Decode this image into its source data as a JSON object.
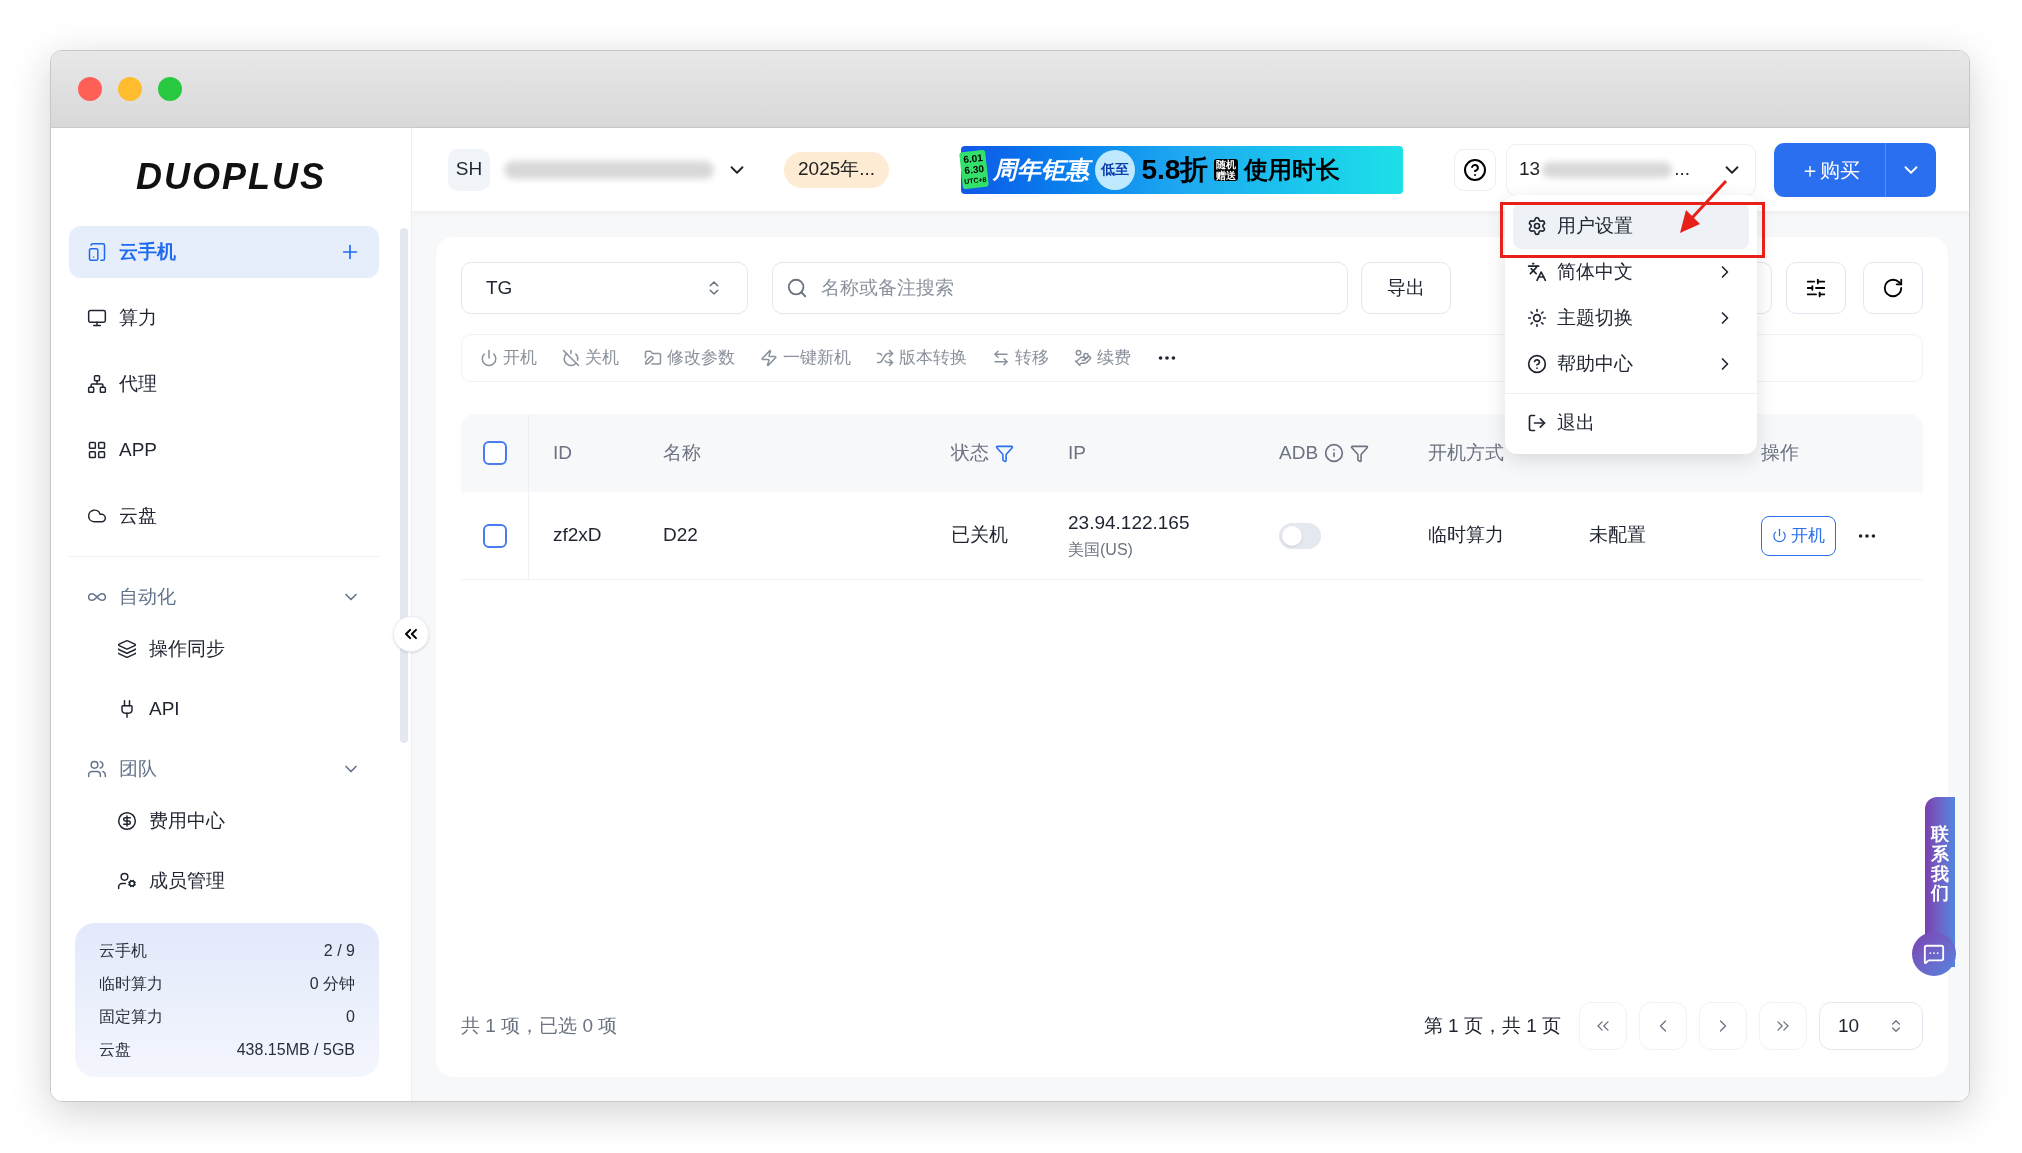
{
  "logo": "DUOPLUS",
  "sidebar": {
    "items": [
      {
        "label": "云手机",
        "selected": true,
        "kind": "link"
      },
      {
        "label": "算力",
        "selected": false,
        "kind": "link"
      },
      {
        "label": "代理",
        "selected": false,
        "kind": "link"
      },
      {
        "label": "APP",
        "selected": false,
        "kind": "link"
      },
      {
        "label": "云盘",
        "selected": false,
        "kind": "link"
      },
      {
        "label": "自动化",
        "kind": "group",
        "expanded": true,
        "children": [
          {
            "label": "操作同步",
            "selected": false
          },
          {
            "label": "API",
            "selected": false
          }
        ]
      },
      {
        "label": "团队",
        "kind": "group",
        "expanded": true,
        "children": [
          {
            "label": "费用中心",
            "selected": false
          },
          {
            "label": "成员管理",
            "selected": false
          }
        ]
      }
    ],
    "stats": [
      {
        "label": "云手机",
        "value": "2 / 9"
      },
      {
        "label": "临时算力",
        "value": "0 分钟"
      },
      {
        "label": "固定算力",
        "value": "0"
      },
      {
        "label": "云盘",
        "value": "438.15MB / 5GB"
      }
    ]
  },
  "header": {
    "avatar": "SH",
    "plan_badge": "2025年...",
    "banner": {
      "tag": [
        "6.01",
        "6.30",
        "UTC+8"
      ],
      "title": "周年钜惠",
      "low": "低至",
      "discount": "5.8折",
      "gift": "随机赠送",
      "tail": "使用时长"
    },
    "account_prefix": "13",
    "account_suffix": "...",
    "buy_button": "＋购买"
  },
  "account_menu": {
    "items": [
      {
        "label": "用户设置",
        "selected": true,
        "submenu": false
      },
      {
        "label": "简体中文",
        "selected": false,
        "submenu": true
      },
      {
        "label": "主题切换",
        "selected": false,
        "submenu": true
      },
      {
        "label": "帮助中心",
        "selected": false,
        "submenu": true
      },
      {
        "label": "退出",
        "selected": false,
        "submenu": false
      }
    ]
  },
  "filters": {
    "group_select": "TG",
    "search": {
      "placeholder": "名称或备注搜索"
    },
    "export_button": "导出"
  },
  "actions": [
    "开机",
    "关机",
    "修改参数",
    "一键新机",
    "版本转换",
    "转移",
    "续费"
  ],
  "table": {
    "select_all_checked": false,
    "columns": [
      {
        "label": "ID"
      },
      {
        "label": "名称"
      },
      {
        "label": "状态",
        "filter": true,
        "filter_active": true
      },
      {
        "label": "IP"
      },
      {
        "label": "ADB",
        "info": true,
        "filter": true,
        "filter_active": false
      },
      {
        "label": "开机方式"
      },
      {
        "label": "操作"
      }
    ],
    "rows": [
      {
        "checked": false,
        "id": "zf2xD",
        "name": "D22",
        "status": "已关机",
        "ip": "23.94.122.165",
        "region": "美国(US)",
        "adb_on": false,
        "boot_mode": "临时算力",
        "column_7": "未配置",
        "action": "开机"
      }
    ]
  },
  "footer": {
    "summary": "共 1 项，已选 0 项",
    "page_info": "第 1 页，共 1 页",
    "page_size": "10"
  },
  "contact_tab": "联系我们"
}
